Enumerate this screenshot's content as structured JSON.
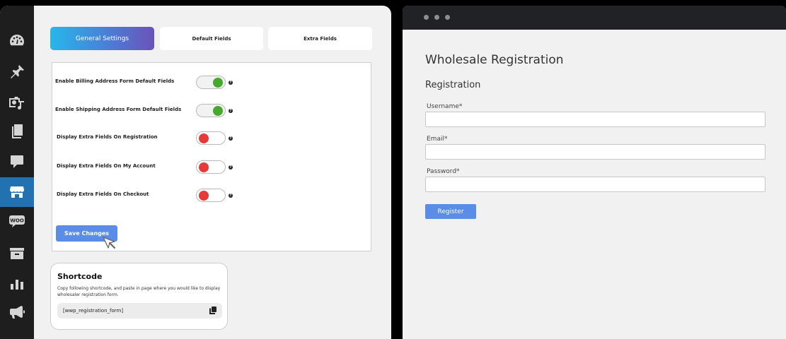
{
  "tabs": [
    {
      "label": "General Settings",
      "active": true
    },
    {
      "label": "Default Fields",
      "active": false
    },
    {
      "label": "Extra Fields",
      "active": false
    }
  ],
  "settings": [
    {
      "label": "Enable Billing Address Form Default Fields",
      "enabled": true
    },
    {
      "label": "Enable Shipping Address Form Default Fields",
      "enabled": true
    },
    {
      "label": "Display Extra Fields On Registration",
      "enabled": false
    },
    {
      "label": "Display Extra Fields On My Account",
      "enabled": false
    },
    {
      "label": "Display Extra Fields On Checkout",
      "enabled": false
    }
  ],
  "help_glyph": "?",
  "save_label": "Save Changes",
  "shortcode": {
    "title": "Shortcode",
    "description": "Copy following shortcode, and paste in page where you would like to display wholesaler registration form.",
    "code": "[wwp_registration_form]"
  },
  "sidebar_icons": [
    "dashboard-icon",
    "pin-icon",
    "media-icon",
    "pages-icon",
    "comments-icon",
    "store-icon",
    "woo-icon",
    "archive-icon",
    "analytics-icon",
    "megaphone-icon"
  ],
  "woo_text": "WOO",
  "registration": {
    "title": "Wholesale Registration",
    "subtitle": "Registration",
    "fields": [
      {
        "label": "Username*",
        "value": ""
      },
      {
        "label": "Email*",
        "value": ""
      },
      {
        "label": "Password*",
        "value": ""
      }
    ],
    "button_label": "Register"
  },
  "colors": {
    "accent": "#5b8de8",
    "toggle_on": "#45a92c",
    "toggle_off": "#e63a3a",
    "sidebar_active": "#2271b1"
  }
}
